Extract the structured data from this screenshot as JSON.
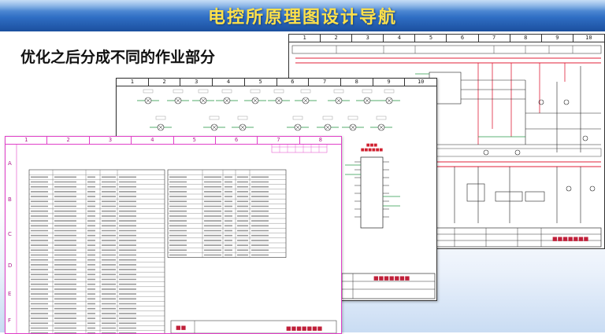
{
  "slide": {
    "title": "电控所原理图设计导航",
    "subtitle": "优化之后分成不同的作业部分"
  },
  "sheet_right": {
    "columns": [
      "1",
      "2",
      "3",
      "4",
      "5",
      "6",
      "7",
      "8",
      "9",
      "10"
    ]
  },
  "sheet_middle": {
    "columns": [
      "1",
      "2",
      "3",
      "4",
      "5",
      "6",
      "7",
      "8",
      "9",
      "10"
    ]
  },
  "sheet_front": {
    "columns": [
      "1",
      "2",
      "3",
      "4",
      "5",
      "6",
      "7",
      "8"
    ],
    "rows": [
      "A",
      "B",
      "C",
      "D",
      "E",
      "F"
    ]
  },
  "colors": {
    "banner": "#2f6ec4",
    "title": "#ffe14a",
    "wire_red": "#e0203a",
    "wire_green": "#2a9a4a",
    "front_border": "#e040c8"
  }
}
